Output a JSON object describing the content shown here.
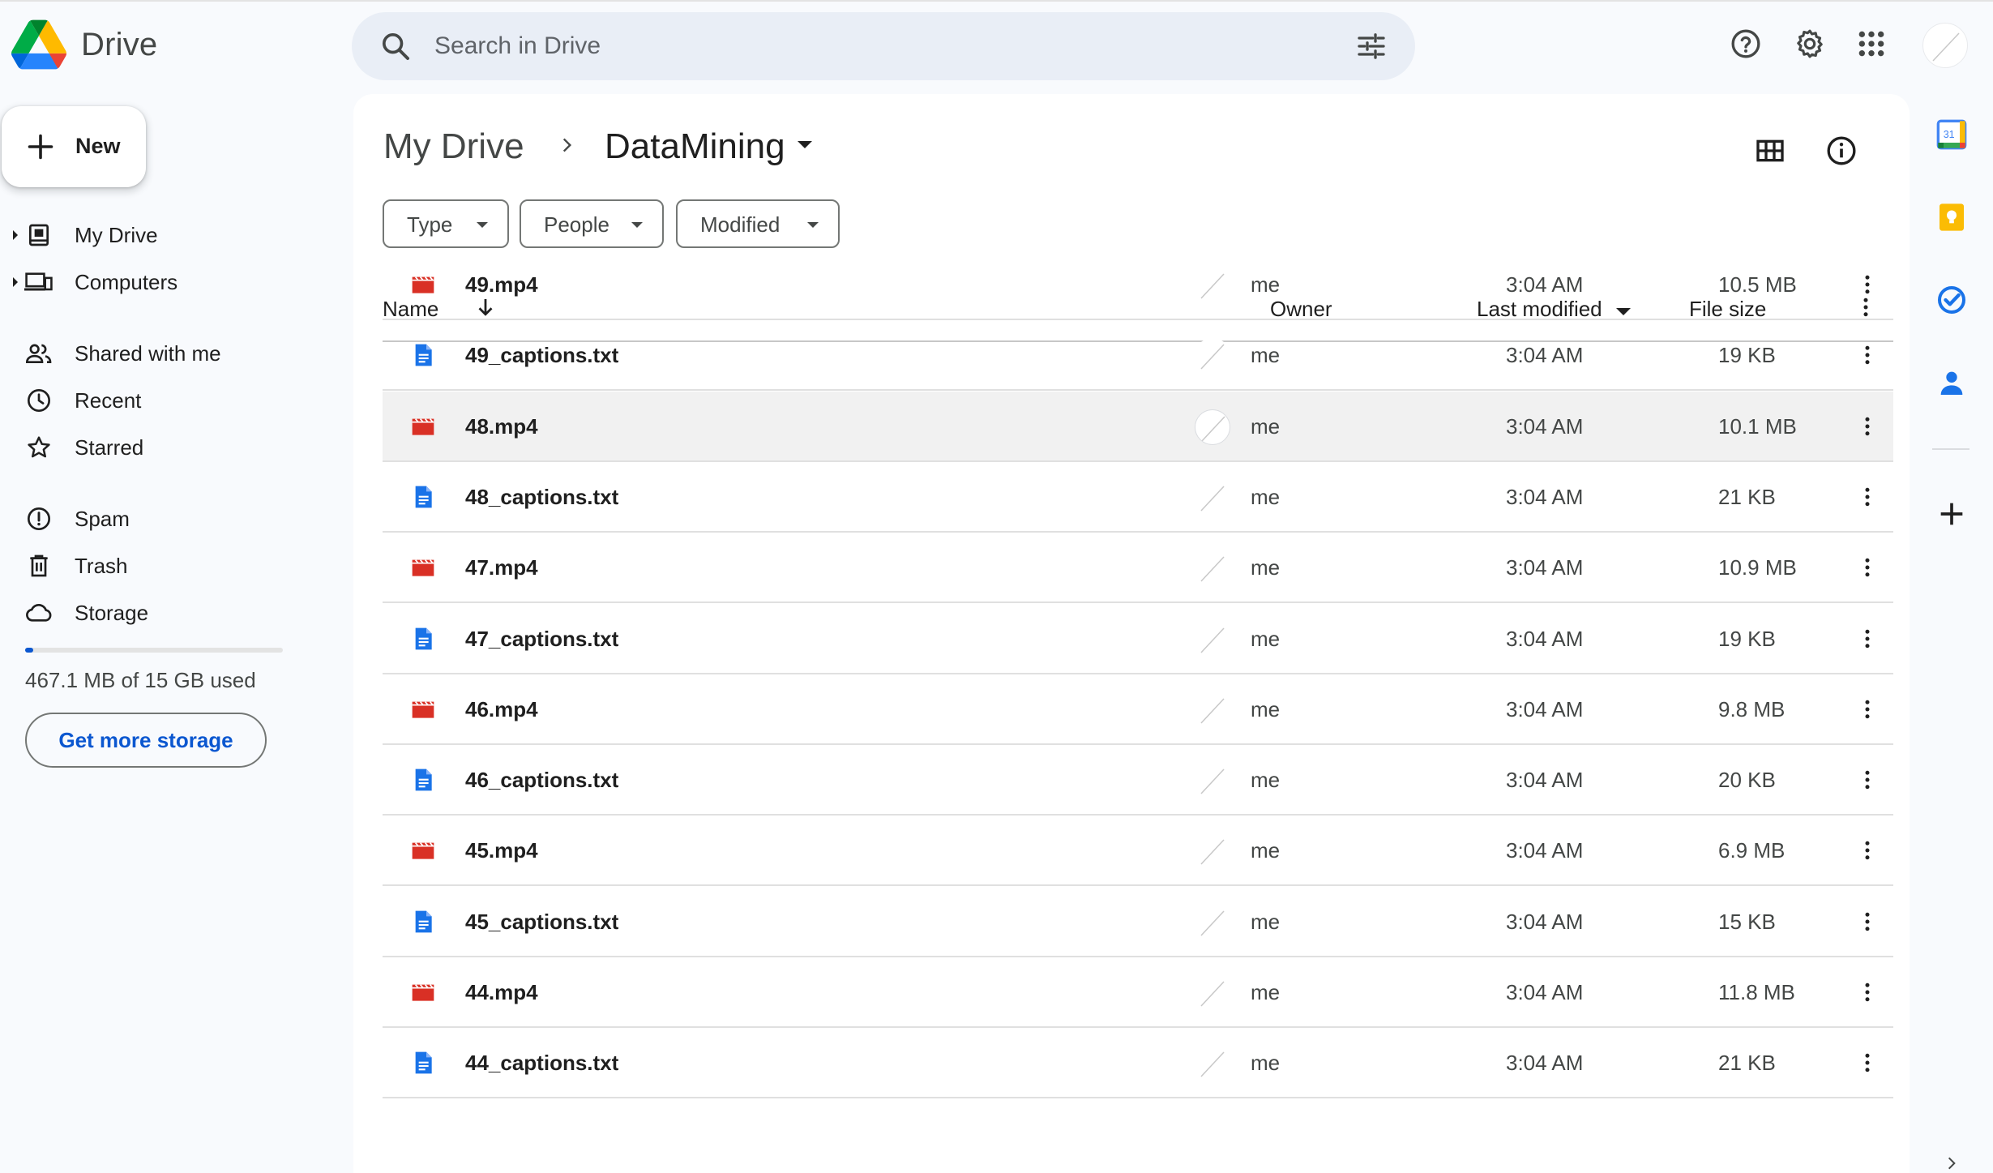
{
  "app": {
    "name": "Drive"
  },
  "search": {
    "placeholder": "Search in Drive",
    "value": ""
  },
  "header_icons": [
    "search-icon",
    "tune-icon",
    "help-icon",
    "settings-icon",
    "apps-icon",
    "avatar"
  ],
  "sidebar": {
    "new_label": "New",
    "items": [
      {
        "label": "My Drive",
        "icon": "my-drive-icon",
        "expandable": true
      },
      {
        "label": "Computers",
        "icon": "computers-icon",
        "expandable": true
      },
      {
        "label": "Shared with me",
        "icon": "shared-icon",
        "expandable": false
      },
      {
        "label": "Recent",
        "icon": "clock-icon",
        "expandable": false
      },
      {
        "label": "Starred",
        "icon": "star-icon",
        "expandable": false
      },
      {
        "label": "Spam",
        "icon": "spam-icon",
        "expandable": false
      },
      {
        "label": "Trash",
        "icon": "trash-icon",
        "expandable": false
      },
      {
        "label": "Storage",
        "icon": "cloud-icon",
        "expandable": false
      }
    ],
    "storage": {
      "used_fraction": 0.03,
      "text": "467.1 MB of 15 GB used",
      "button": "Get more storage"
    }
  },
  "breadcrumb": {
    "root": "My Drive",
    "current": "DataMining"
  },
  "filters": [
    "Type",
    "People",
    "Modified"
  ],
  "table": {
    "headers": {
      "name": "Name",
      "owner": "Owner",
      "modified": "Last modified",
      "size": "File size"
    },
    "rows": [
      {
        "name": "49.mp4",
        "type": "video",
        "owner": "me",
        "modified": "3:04 AM",
        "size": "10.5 MB"
      },
      {
        "name": "49_captions.txt",
        "type": "doc",
        "owner": "me",
        "modified": "3:04 AM",
        "size": "19 KB"
      },
      {
        "name": "48.mp4",
        "type": "video",
        "owner": "me",
        "modified": "3:04 AM",
        "size": "10.1 MB",
        "selected": true
      },
      {
        "name": "48_captions.txt",
        "type": "doc",
        "owner": "me",
        "modified": "3:04 AM",
        "size": "21 KB"
      },
      {
        "name": "47.mp4",
        "type": "video",
        "owner": "me",
        "modified": "3:04 AM",
        "size": "10.9 MB"
      },
      {
        "name": "47_captions.txt",
        "type": "doc",
        "owner": "me",
        "modified": "3:04 AM",
        "size": "19 KB"
      },
      {
        "name": "46.mp4",
        "type": "video",
        "owner": "me",
        "modified": "3:04 AM",
        "size": "9.8 MB"
      },
      {
        "name": "46_captions.txt",
        "type": "doc",
        "owner": "me",
        "modified": "3:04 AM",
        "size": "20 KB"
      },
      {
        "name": "45.mp4",
        "type": "video",
        "owner": "me",
        "modified": "3:04 AM",
        "size": "6.9 MB"
      },
      {
        "name": "45_captions.txt",
        "type": "doc",
        "owner": "me",
        "modified": "3:04 AM",
        "size": "15 KB"
      },
      {
        "name": "44.mp4",
        "type": "video",
        "owner": "me",
        "modified": "3:04 AM",
        "size": "11.8 MB"
      },
      {
        "name": "44_captions.txt",
        "type": "doc",
        "owner": "me",
        "modified": "3:04 AM",
        "size": "21 KB"
      }
    ]
  },
  "side_apps": [
    {
      "name": "calendar-icon",
      "text": "31"
    },
    {
      "name": "keep-icon"
    },
    {
      "name": "tasks-icon"
    },
    {
      "name": "contacts-icon"
    },
    {
      "name": "add-icon"
    }
  ],
  "colors": {
    "accent": "#0b57d0",
    "video_icon": "#d93025",
    "doc_icon": "#1a73e8",
    "selected_row": "#f1f1f1",
    "page_bg": "#f8fafd"
  }
}
